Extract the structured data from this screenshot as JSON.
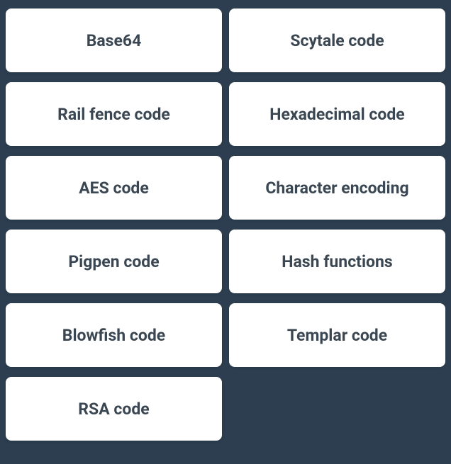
{
  "cards": [
    {
      "label": "Base64"
    },
    {
      "label": "Scytale code"
    },
    {
      "label": "Rail fence code"
    },
    {
      "label": "Hexadecimal code"
    },
    {
      "label": "AES code"
    },
    {
      "label": "Character encoding"
    },
    {
      "label": "Pigpen code"
    },
    {
      "label": "Hash functions"
    },
    {
      "label": "Blowfish code"
    },
    {
      "label": "Templar code"
    },
    {
      "label": "RSA code"
    }
  ]
}
